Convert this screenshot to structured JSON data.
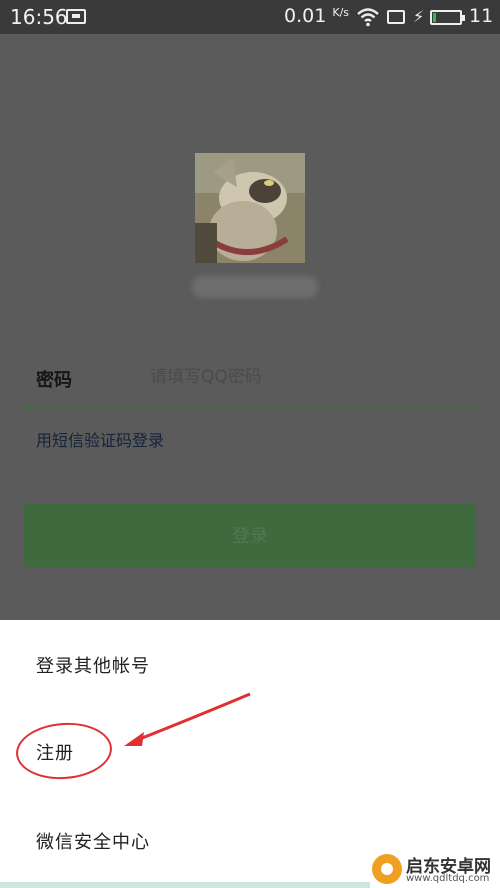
{
  "status_bar": {
    "time": "16:56",
    "net_speed": "0.01",
    "net_unit": "K/s",
    "battery_level": "11",
    "battery_fraction": 0.11,
    "icons": [
      "notification-icon",
      "wifi-icon",
      "screen-icon",
      "charging-bolt-icon",
      "battery-icon"
    ]
  },
  "login": {
    "password_label": "密码",
    "password_placeholder": "请填写QQ密码",
    "sms_login_link": "用短信验证码登录",
    "login_button": "登录"
  },
  "sheet": {
    "items": [
      "登录其他帐号",
      "注册",
      "微信安全中心"
    ]
  },
  "watermark": {
    "title": "启东安卓网",
    "url": "www.qdltdq.com"
  },
  "colors": {
    "overlay": "#5b5b5b",
    "login_button": "#3e6a3e",
    "annotation": "#e03030",
    "battery": "#2fbf3b"
  }
}
